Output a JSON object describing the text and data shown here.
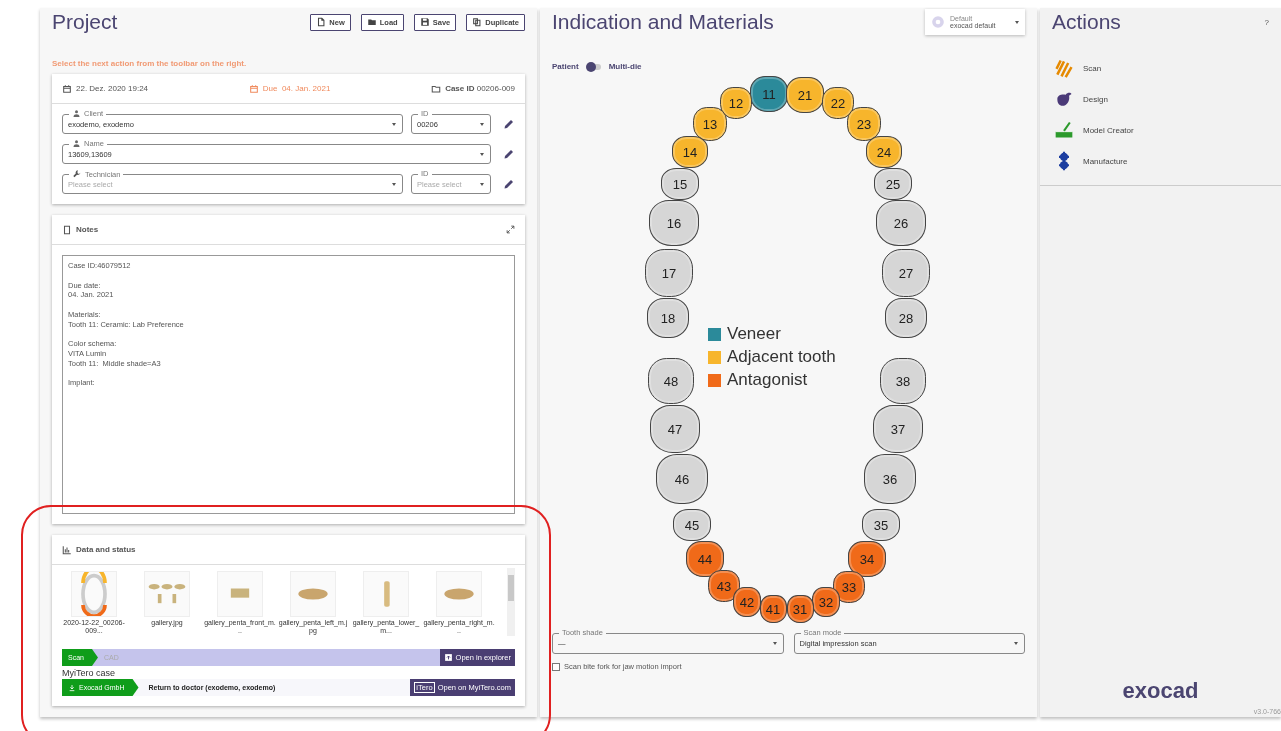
{
  "project": {
    "title": "Project",
    "toolbar": [
      {
        "kind": "new",
        "label": "New"
      },
      {
        "kind": "load",
        "label": "Load"
      },
      {
        "kind": "save",
        "label": "Save"
      },
      {
        "kind": "duplicate",
        "label": "Duplicate"
      }
    ],
    "hint": "Select the next action from the toolbar on the right.",
    "case": {
      "created": "22. Dez. 2020 19:24",
      "due_label": "Due",
      "due": "04. Jan. 2021",
      "case_id_label": "Case ID",
      "case_id": "00206-009"
    },
    "fields": [
      {
        "kind": "client",
        "label": "Client",
        "value": "exodemo, exodemo",
        "id": {
          "label": "ID",
          "value": "00206"
        }
      },
      {
        "kind": "name",
        "label": "Name",
        "value": "13609,13609"
      },
      {
        "kind": "technician",
        "label": "Technician",
        "placeholder": "Please select",
        "id": {
          "label": "ID",
          "placeholder": "Please select"
        }
      }
    ],
    "notes": {
      "title": "Notes",
      "text": "Case ID:46079512\n\nDue date:\n04. Jan. 2021\n\nMaterials:\nTooth 11: Ceramic: Lab Preference\n\nColor schema:\nVITA Lumin\nTooth 11:  Middle shade=A3\n\nImplant:"
    },
    "data": {
      "title": "Data and status",
      "files": [
        {
          "kind": "arch",
          "name": "2020-12-22_00206-009..."
        },
        {
          "kind": "gallery",
          "name": "gallery.jpg"
        },
        {
          "kind": "front",
          "name": "gallery_penta_front_m..."
        },
        {
          "kind": "side",
          "name": "gallery_penta_left_m.jpg"
        },
        {
          "kind": "lower",
          "name": "gallery_penta_lower_m..."
        },
        {
          "kind": "side",
          "name": "gallery_penta_right_m..."
        }
      ],
      "workflow": [
        {
          "label": "Scan",
          "done": true
        },
        {
          "label": "CAD",
          "done": false
        }
      ],
      "explorer_button": "Open in explorer",
      "itero": {
        "title": "MyiTero case",
        "sender": "Exocad GmbH",
        "status": "Return to doctor (exodemo, exodemo)",
        "logo": "iTero",
        "button": "Open on MyiTero.com"
      }
    }
  },
  "indication": {
    "title": "Indication and Materials",
    "preset": {
      "label": "Default",
      "value": "exocad default"
    },
    "mode": {
      "left": "Patient",
      "right": "Multi-die",
      "multi_die": false
    },
    "legend": [
      {
        "label": "Veneer",
        "color": "#2b8a9a"
      },
      {
        "label": "Adjacent tooth",
        "color": "#f7b52c"
      },
      {
        "label": "Antagonist",
        "color": "#f06a19"
      }
    ],
    "teeth": [
      {
        "number": "11",
        "kind": "veneer"
      },
      {
        "number": "21",
        "kind": "adjacent"
      },
      {
        "number": "12",
        "kind": "adjacent"
      },
      {
        "number": "22",
        "kind": "adjacent"
      },
      {
        "number": "13",
        "kind": "adjacent"
      },
      {
        "number": "23",
        "kind": "adjacent"
      },
      {
        "number": "14",
        "kind": "adjacent"
      },
      {
        "number": "24",
        "kind": "adjacent"
      },
      {
        "number": "15",
        "kind": "none"
      },
      {
        "number": "25",
        "kind": "none"
      },
      {
        "number": "16",
        "kind": "none"
      },
      {
        "number": "26",
        "kind": "none"
      },
      {
        "number": "17",
        "kind": "none"
      },
      {
        "number": "27",
        "kind": "none"
      },
      {
        "number": "18",
        "kind": "none"
      },
      {
        "number": "28",
        "kind": "none"
      },
      {
        "number": "48",
        "kind": "none"
      },
      {
        "number": "38",
        "kind": "none"
      },
      {
        "number": "47",
        "kind": "none"
      },
      {
        "number": "37",
        "kind": "none"
      },
      {
        "number": "46",
        "kind": "none"
      },
      {
        "number": "36",
        "kind": "none"
      },
      {
        "number": "45",
        "kind": "none"
      },
      {
        "number": "35",
        "kind": "none"
      },
      {
        "number": "44",
        "kind": "antagonist"
      },
      {
        "number": "34",
        "kind": "antagonist"
      },
      {
        "number": "43",
        "kind": "antagonist"
      },
      {
        "number": "33",
        "kind": "antagonist"
      },
      {
        "number": "42",
        "kind": "antagonist"
      },
      {
        "number": "32",
        "kind": "antagonist"
      },
      {
        "number": "41",
        "kind": "antagonist"
      },
      {
        "number": "31",
        "kind": "antagonist"
      }
    ],
    "tooth_shade": {
      "label": "Tooth shade",
      "value": "—"
    },
    "scan_mode": {
      "label": "Scan mode",
      "value": "Digital impression scan"
    },
    "bite_fork": {
      "label": "Scan bite fork for jaw motion import",
      "checked": false
    }
  },
  "actions": {
    "title": "Actions",
    "help": "?",
    "items": [
      {
        "kind": "scan",
        "label": "Scan"
      },
      {
        "kind": "design",
        "label": "Design"
      },
      {
        "kind": "model",
        "label": "Model Creator"
      },
      {
        "kind": "manufacture",
        "label": "Manufacture"
      }
    ],
    "logo": "exocad",
    "version": "v3.0-766"
  }
}
